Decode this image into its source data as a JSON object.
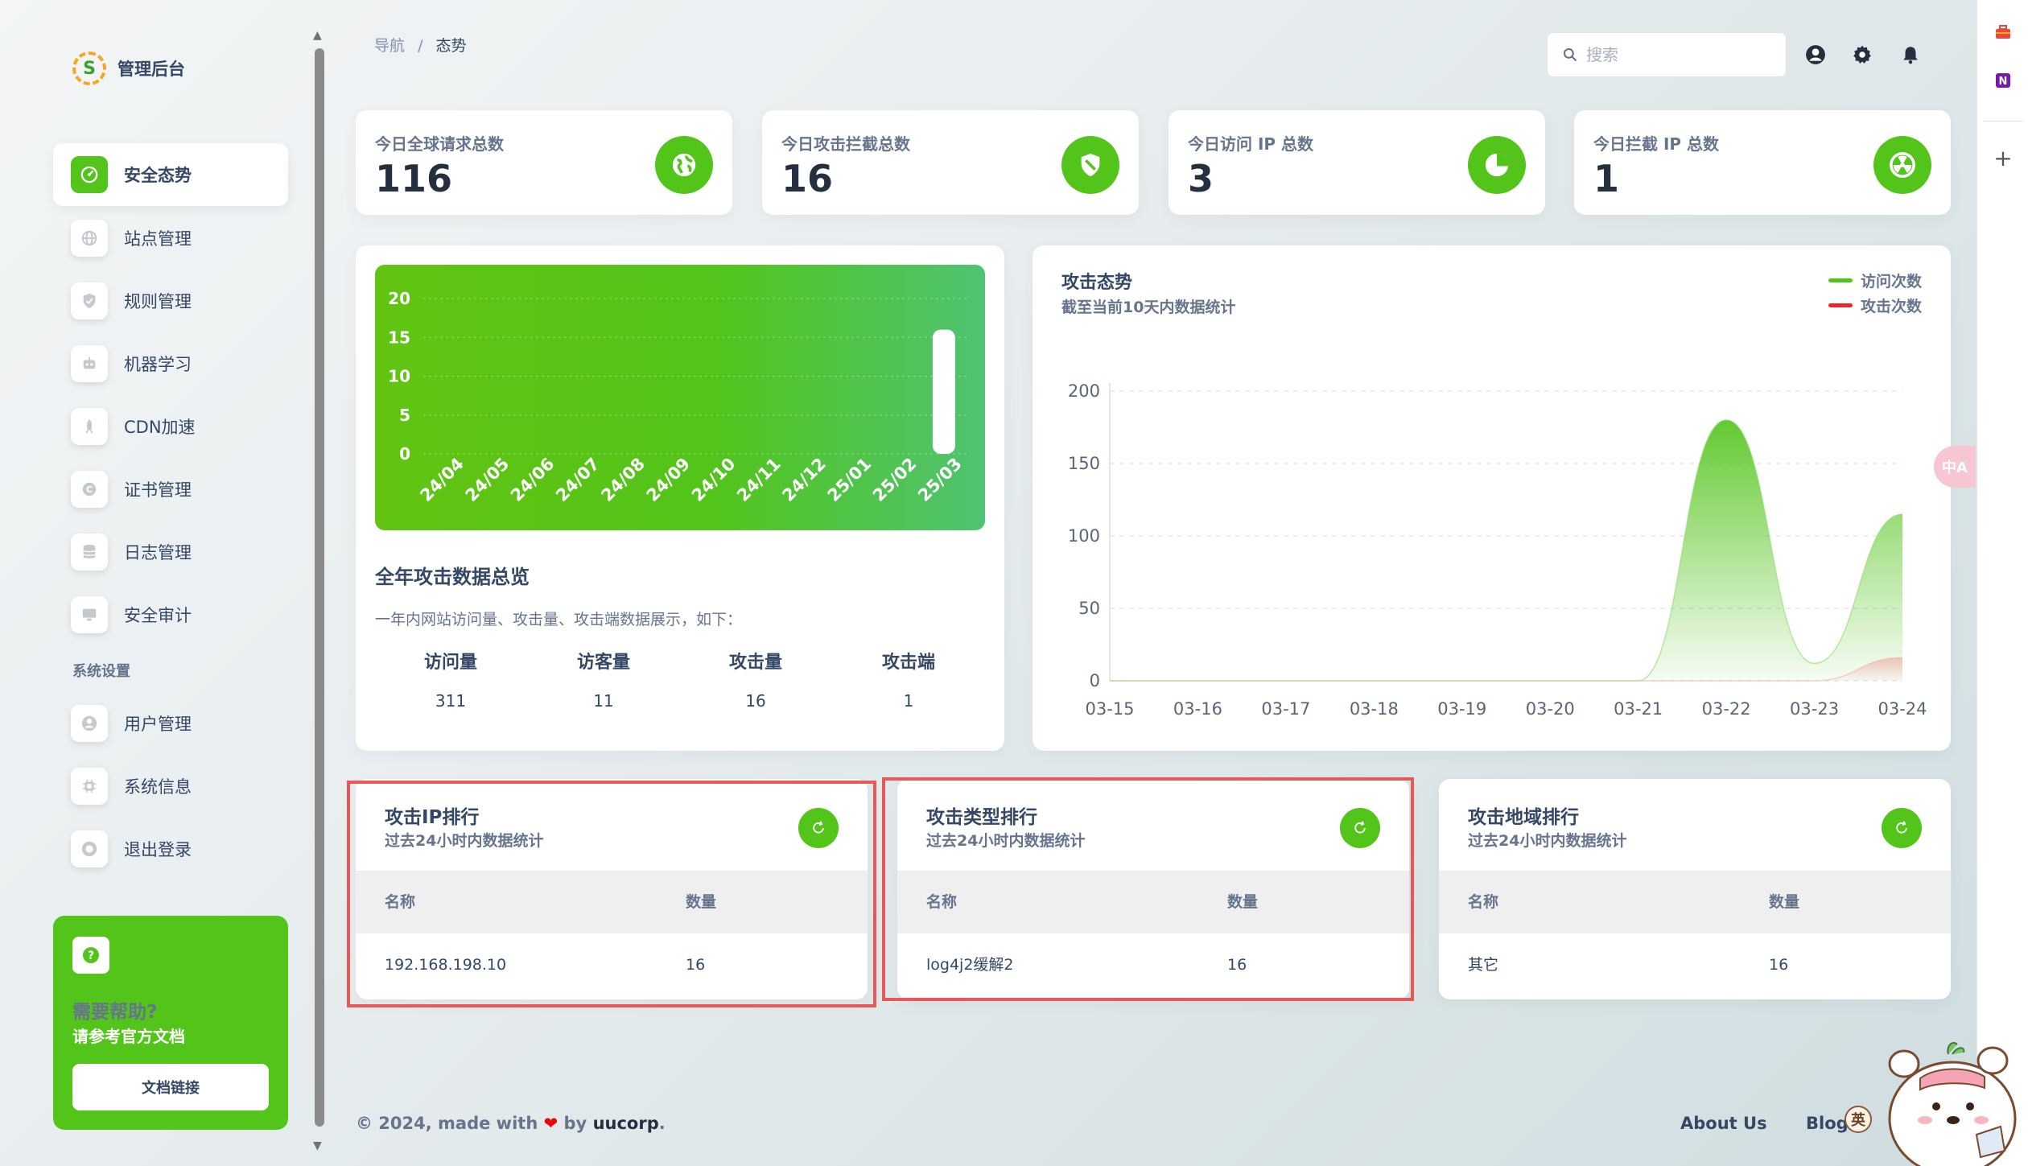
{
  "sidebar": {
    "brand_title": "管理后台",
    "brand_letter": "S",
    "items": [
      {
        "label": "安全态势",
        "icon": "dashboard-icon",
        "active": true
      },
      {
        "label": "站点管理",
        "icon": "globe-icon",
        "active": false
      },
      {
        "label": "规则管理",
        "icon": "shield-icon",
        "active": false
      },
      {
        "label": "机器学习",
        "icon": "robot-icon",
        "active": false
      },
      {
        "label": "CDN加速",
        "icon": "rocket-icon",
        "active": false
      },
      {
        "label": "证书管理",
        "icon": "certificate-icon",
        "active": false
      },
      {
        "label": "日志管理",
        "icon": "database-icon",
        "active": false
      },
      {
        "label": "安全审计",
        "icon": "monitor-icon",
        "active": false
      }
    ],
    "section_title": "系统设置",
    "settings_items": [
      {
        "label": "用户管理",
        "icon": "user-icon"
      },
      {
        "label": "系统信息",
        "icon": "chip-icon"
      },
      {
        "label": "退出登录",
        "icon": "logout-icon"
      }
    ],
    "help": {
      "question_mark": "?",
      "title": "需要帮助?",
      "subtitle": "请参考官方文档",
      "button": "文档链接"
    }
  },
  "header": {
    "breadcrumb_root": "导航",
    "breadcrumb_sep": "/",
    "breadcrumb_current": "态势",
    "search_placeholder": "搜索"
  },
  "stats": [
    {
      "label": "今日全球请求总数",
      "value": "116",
      "icon": "globe-icon"
    },
    {
      "label": "今日攻击拦截总数",
      "value": "16",
      "icon": "shield-icon"
    },
    {
      "label": "今日访问 IP 总数",
      "value": "3",
      "icon": "pie-chart-icon"
    },
    {
      "label": "今日拦截 IP 总数",
      "value": "1",
      "icon": "radiation-icon"
    }
  ],
  "overview": {
    "title": "全年攻击数据总览",
    "desc": "一年内网站访问量、攻击量、攻击端数据展示，如下：",
    "columns": [
      {
        "head": "访问量",
        "value": "311"
      },
      {
        "head": "访客量",
        "value": "11"
      },
      {
        "head": "攻击量",
        "value": "16"
      },
      {
        "head": "攻击端",
        "value": "1"
      }
    ]
  },
  "attack_chart": {
    "title": "攻击态势",
    "subtitle": "截至当前10天内数据统计",
    "legend": [
      {
        "name": "访问次数",
        "color": "#52c41a"
      },
      {
        "name": "攻击次数",
        "color": "#f5222d"
      }
    ]
  },
  "rankings": [
    {
      "title": "攻击IP排行",
      "subtitle": "过去24小时内数据统计",
      "col_name": "名称",
      "col_count": "数量",
      "row_name": "192.168.198.10",
      "row_count": "16"
    },
    {
      "title": "攻击类型排行",
      "subtitle": "过去24小时内数据统计",
      "col_name": "名称",
      "col_count": "数量",
      "row_name": "log4j2缓解2",
      "row_count": "16"
    },
    {
      "title": "攻击地域排行",
      "subtitle": "过去24小时内数据统计",
      "col_name": "名称",
      "col_count": "数量",
      "row_name": "其它",
      "row_count": "16"
    }
  ],
  "footer": {
    "prefix": "© 2024, made with",
    "heart": "❤",
    "by": "by",
    "author": "uucorp",
    "dot": ".",
    "about": "About Us",
    "blog": "Blog"
  },
  "extras": {
    "translate_label": "中A",
    "ime_label": "英",
    "plus": "+"
  },
  "chart_data": [
    {
      "type": "bar",
      "categories": [
        "24/04",
        "24/05",
        "24/06",
        "24/07",
        "24/08",
        "24/09",
        "24/10",
        "24/11",
        "24/12",
        "25/01",
        "25/02",
        "25/03"
      ],
      "values": [
        0,
        0,
        0,
        0,
        0,
        0,
        0,
        0,
        0,
        0,
        0,
        16
      ],
      "yticks": [
        "0",
        "5",
        "10",
        "15",
        "20"
      ],
      "ylim": [
        0,
        20
      ],
      "grid": true
    },
    {
      "type": "area",
      "categories": [
        "03-15",
        "03-16",
        "03-17",
        "03-18",
        "03-19",
        "03-20",
        "03-21",
        "03-22",
        "03-23",
        "03-24"
      ],
      "yticks": [
        "0",
        "50",
        "100",
        "150",
        "200"
      ],
      "ylim": [
        0,
        200
      ],
      "series": [
        {
          "name": "访问次数",
          "values": [
            0,
            0,
            0,
            0,
            0,
            0,
            0,
            180,
            12,
            115
          ]
        },
        {
          "name": "攻击次数",
          "values": [
            0,
            0,
            0,
            0,
            0,
            0,
            0,
            0,
            0,
            16
          ]
        }
      ],
      "grid": true,
      "legend": "top-right"
    }
  ]
}
